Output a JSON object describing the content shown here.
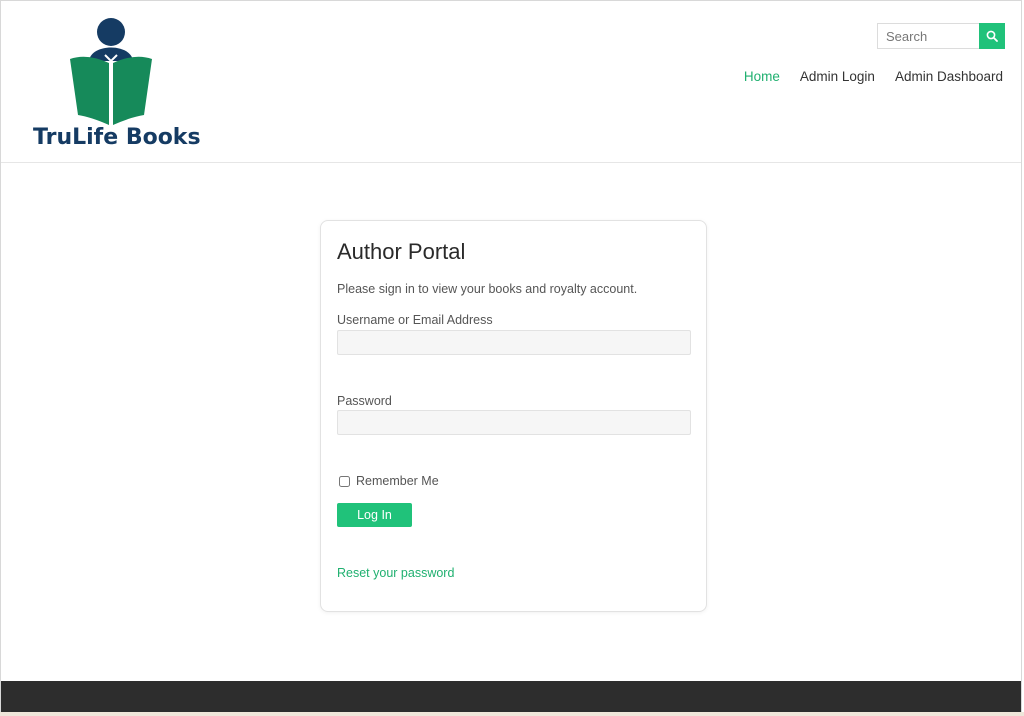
{
  "brand": {
    "name": "TruLife Books",
    "text_color": "#153b63",
    "book_color": "#168a5a",
    "head_color": "#153b63"
  },
  "search": {
    "placeholder": "Search",
    "button_color": "#20c27a"
  },
  "nav": {
    "items": [
      {
        "label": "Home",
        "active": true
      },
      {
        "label": "Admin Login",
        "active": false
      },
      {
        "label": "Admin Dashboard",
        "active": false
      }
    ],
    "active_color": "#20b070"
  },
  "login": {
    "title": "Author Portal",
    "description": "Please sign in to view your books and royalty account.",
    "username_label": "Username or Email Address",
    "username_value": "",
    "password_label": "Password",
    "password_value": "",
    "remember_label": "Remember Me",
    "remember_checked": false,
    "submit_label": "Log In",
    "reset_label": "Reset your password"
  },
  "colors": {
    "accent": "#20c27a",
    "footer": "#2d2d2d"
  }
}
